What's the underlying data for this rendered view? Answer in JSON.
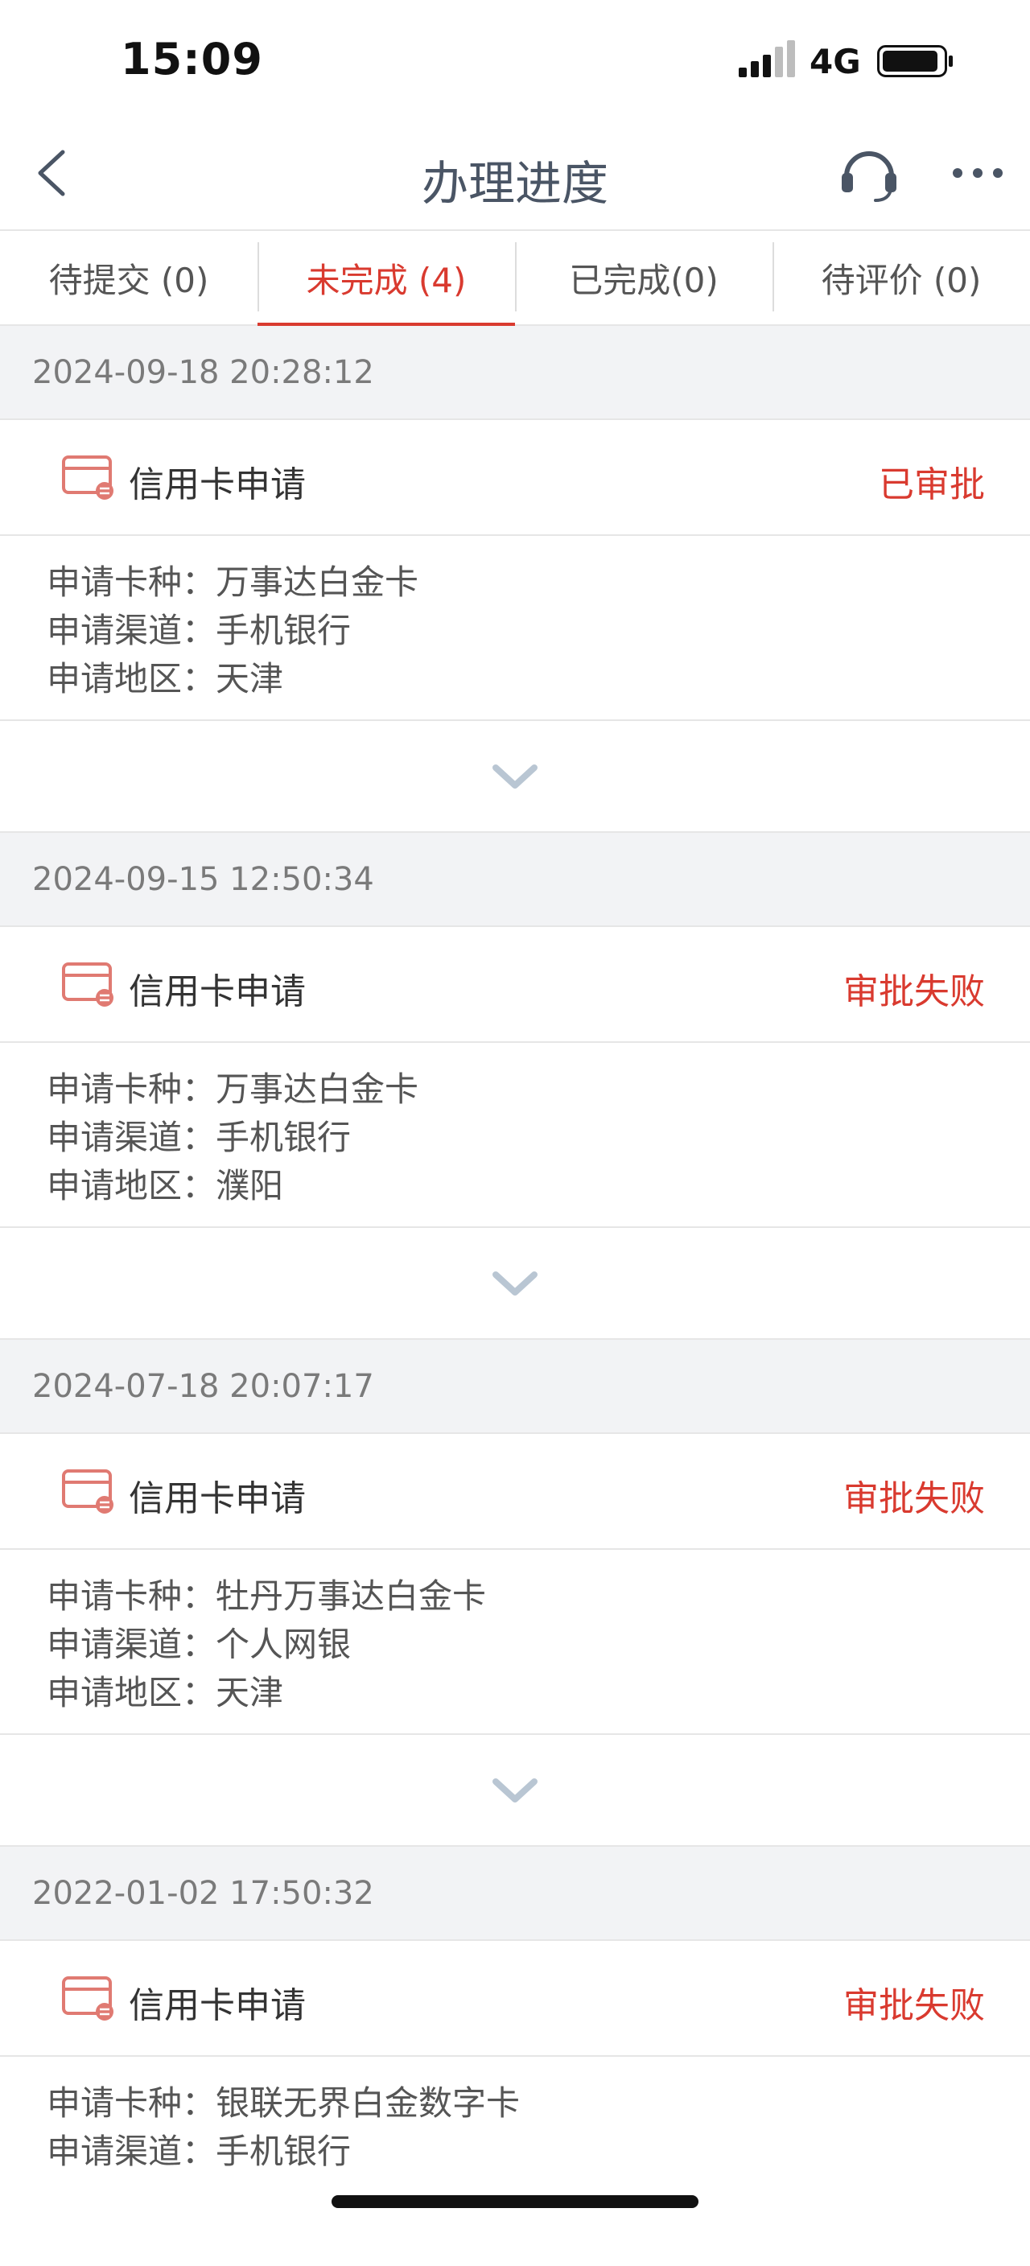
{
  "status_bar": {
    "time": "15:09",
    "network": "4G"
  },
  "nav": {
    "title": "办理进度",
    "back_icon": "chevron-left-icon",
    "service_icon": "headset-icon",
    "more_icon": "more-dots-icon"
  },
  "tabs": [
    {
      "label": "待提交 (0)",
      "active": false
    },
    {
      "label": "未完成 (4)",
      "active": true
    },
    {
      "label": "已完成(0)",
      "active": false
    },
    {
      "label": "待评价 (0)",
      "active": false
    }
  ],
  "records": [
    {
      "datetime": "2024-09-18 20:28:12",
      "title": "信用卡申请",
      "status": "已审批",
      "details": [
        "申请卡种：万事达白金卡",
        "申请渠道：手机银行",
        "申请地区：天津"
      ]
    },
    {
      "datetime": "2024-09-15 12:50:34",
      "title": "信用卡申请",
      "status": "审批失败",
      "details": [
        "申请卡种：万事达白金卡",
        "申请渠道：手机银行",
        "申请地区：濮阳"
      ]
    },
    {
      "datetime": "2024-07-18 20:07:17",
      "title": "信用卡申请",
      "status": "审批失败",
      "details": [
        "申请卡种：牡丹万事达白金卡",
        "申请渠道：个人网银",
        "申请地区：天津"
      ]
    },
    {
      "datetime": "2022-01-02 17:50:32",
      "title": "信用卡申请",
      "status": "审批失败",
      "details": [
        "申请卡种：银联无界白金数字卡",
        "申请渠道：手机银行"
      ]
    }
  ],
  "colors": {
    "accent": "#d93a2f",
    "title": "#4a5565",
    "background": "#f2f3f5"
  }
}
